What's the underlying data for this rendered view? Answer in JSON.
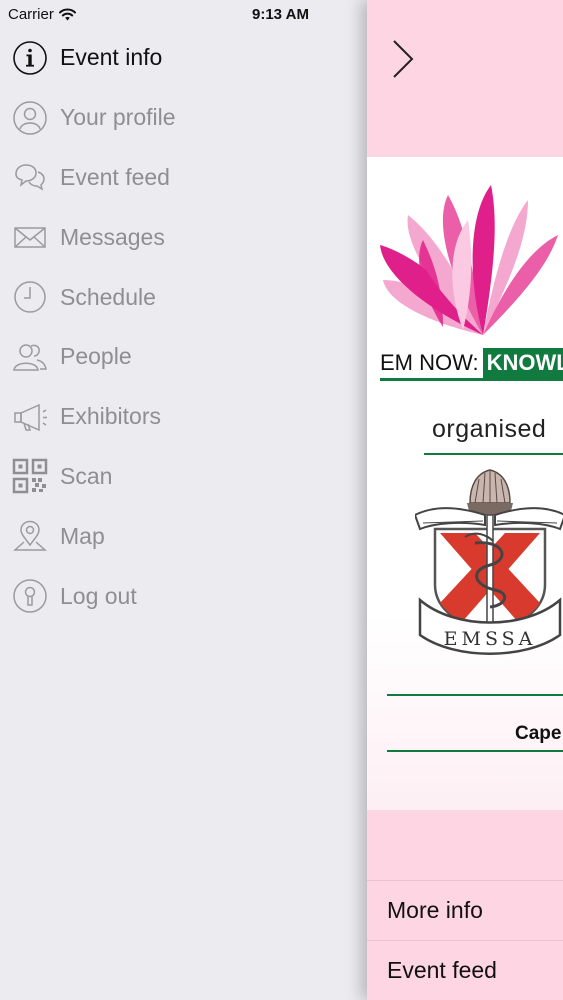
{
  "status_bar": {
    "carrier": "Carrier",
    "time": "9:13 AM",
    "battery_level": 1.0
  },
  "menu": {
    "items": [
      {
        "label": "Event info",
        "icon": "info-icon",
        "active": true
      },
      {
        "label": "Your profile",
        "icon": "profile-icon",
        "active": false
      },
      {
        "label": "Event feed",
        "icon": "chat-bubbles-icon",
        "active": false
      },
      {
        "label": "Messages",
        "icon": "envelope-icon",
        "active": false
      },
      {
        "label": "Schedule",
        "icon": "clock-icon",
        "active": false
      },
      {
        "label": "People",
        "icon": "people-icon",
        "active": false
      },
      {
        "label": "Exhibitors",
        "icon": "megaphone-icon",
        "active": false
      },
      {
        "label": "Scan",
        "icon": "qr-code-icon",
        "active": false
      },
      {
        "label": "Map",
        "icon": "map-pin-icon",
        "active": false
      },
      {
        "label": "Log out",
        "icon": "logout-keyhole-icon",
        "active": false
      }
    ]
  },
  "panel": {
    "banner": {
      "event_text_plain": "EM NOW:",
      "event_text_highlight": "KNOWL",
      "organised": "organised",
      "emblem_text": "EMSSA",
      "city": "Cape"
    },
    "bottom_items": [
      {
        "label": "More info"
      },
      {
        "label": "Event feed"
      }
    ]
  },
  "colors": {
    "menu_background": "#ebebf0",
    "menu_text_active": "#111111",
    "menu_text_inactive": "#8e8e93",
    "panel_background": "#fdd5e3",
    "brand_green": "#117a3e",
    "brand_pink": "#e0208a",
    "emblem_red": "#d83a2e"
  }
}
